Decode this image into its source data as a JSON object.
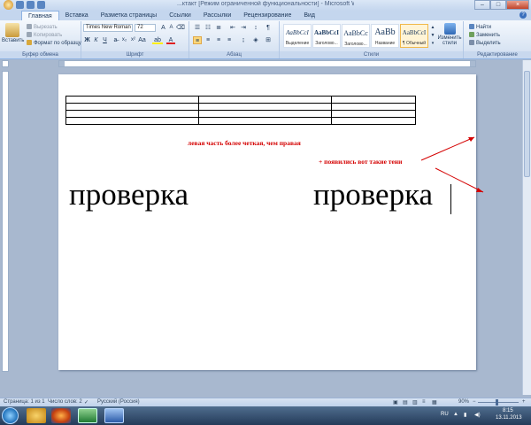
{
  "window": {
    "title": "...ктакт [Режим ограниченной функциональности] - Microsoft Word"
  },
  "tabs": [
    "Главная",
    "Вставка",
    "Разметка страницы",
    "Ссылки",
    "Рассылки",
    "Рецензирование",
    "Вид"
  ],
  "ribbon": {
    "clipboard": {
      "paste": "Вставить",
      "cut": "Вырезать",
      "copy": "Копировать",
      "format_painter": "Формат по образцу",
      "label": "Буфер обмена"
    },
    "font": {
      "name": "Times New Roman",
      "size": "72",
      "label": "Шрифт",
      "bold": "Ж",
      "italic": "К",
      "underline": "Ч"
    },
    "paragraph": {
      "label": "Абзац"
    },
    "styles": {
      "label": "Стили",
      "items": [
        {
          "sample": "AaBbCcI",
          "name": "Выделение"
        },
        {
          "sample": "AaBbCcI",
          "name": "Заголово..."
        },
        {
          "sample": "AaBbCc",
          "name": "Заголово..."
        },
        {
          "sample": "AaBb",
          "name": "Название"
        },
        {
          "sample": "AaBbCcI",
          "name": "¶ Обычный"
        }
      ],
      "change_styles": "Изменить стили"
    },
    "editing": {
      "label": "Редактирование",
      "find": "Найти",
      "replace": "Заменить",
      "select": "Выделить"
    }
  },
  "document": {
    "table": {
      "rows": 4,
      "cols": 3
    },
    "note_left": "левая часть более четкая, чем правая",
    "note_right": "+ появились вот такие тени",
    "word_left": "проверка",
    "word_right": "проверка"
  },
  "statusbar": {
    "page": "Страница: 1 из 1",
    "words": "Число слов: 2",
    "language": "Русский (Россия)",
    "zoom": "90%"
  },
  "taskbar": {
    "lang": "RU",
    "time": "8:15",
    "date": "13.11.2013"
  },
  "colors": {
    "annotation": "#d40000",
    "ribbon_bg": "#dbe6f4",
    "accent": "#3a6fbd"
  }
}
